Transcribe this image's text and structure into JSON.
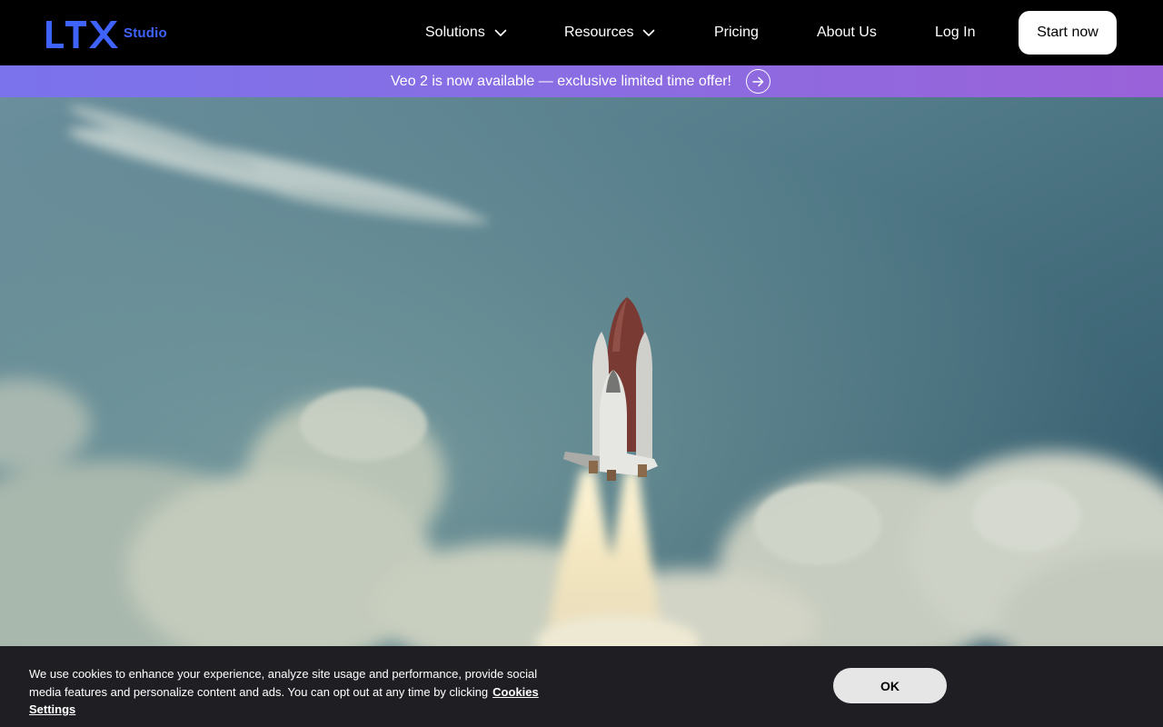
{
  "brand": {
    "logo_letters": "LTX",
    "logo_suffix": "Studio",
    "accent_color": "#3f63ff"
  },
  "nav": {
    "items": [
      {
        "label": "Solutions",
        "has_dropdown": true
      },
      {
        "label": "Resources",
        "has_dropdown": true
      },
      {
        "label": "Pricing",
        "has_dropdown": false
      },
      {
        "label": "About Us",
        "has_dropdown": false
      }
    ],
    "login_label": "Log In",
    "cta_label": "Start now"
  },
  "banner": {
    "text": "Veo 2 is now available — exclusive limited time offer!",
    "icon": "arrow-right-icon"
  },
  "hero": {
    "image": "space-shuttle-launch"
  },
  "cookie": {
    "text": "We use cookies to enhance your experience, analyze site usage and performance, provide social media features and personalize content and ads. You can opt out at any time by clicking",
    "link_label": "Cookies Settings",
    "ok_label": "OK"
  }
}
